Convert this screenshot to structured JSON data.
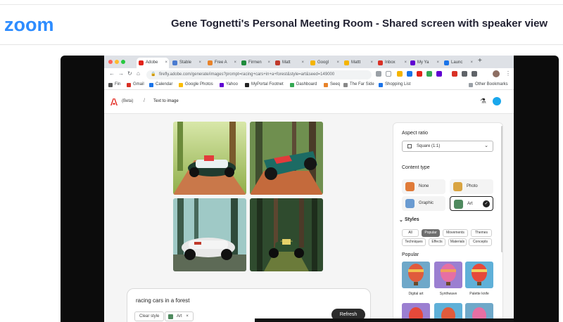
{
  "zoom": {
    "logo": "zoom",
    "meeting_title": "Gene Tognetti's Personal Meeting Room - Shared screen with speaker view"
  },
  "browser": {
    "tabs": [
      {
        "label": "Adobe",
        "icon_color": "#e2231a"
      },
      {
        "label": "Stable",
        "icon_color": "#4a7bd1"
      },
      {
        "label": "Free A",
        "icon_color": "#e8832a"
      },
      {
        "label": "Firmen",
        "icon_color": "#1f8b3b"
      },
      {
        "label": "Matt",
        "icon_color": "#c0392b"
      },
      {
        "label": "Googl",
        "icon_color": "#f4b400"
      },
      {
        "label": "Mattt",
        "icon_color": "#f4b400"
      },
      {
        "label": "Inbox",
        "icon_color": "#d93025"
      },
      {
        "label": "My Ya",
        "icon_color": "#6001d2"
      },
      {
        "label": "Launc",
        "icon_color": "#1a73e8"
      }
    ],
    "new_tab": "+",
    "url": "firefly.adobe.com/generate/images?prompt=racing+cars+in+a+forest&style=art&seed=149000",
    "bookmarks": [
      {
        "label": "Fin",
        "icon_color": "#555555"
      },
      {
        "label": "Gmail",
        "icon_color": "#d93025"
      },
      {
        "label": "Calendar",
        "icon_color": "#1a73e8"
      },
      {
        "label": "Google Photos",
        "icon_color": "#fbbc04"
      },
      {
        "label": "Yahoo",
        "icon_color": "#6001d2"
      },
      {
        "label": "MyPortal Footnet",
        "icon_color": "#222222"
      },
      {
        "label": "Dashboard",
        "icon_color": "#34a853"
      },
      {
        "label": "Seeq",
        "icon_color": "#e8832a"
      },
      {
        "label": "The Far Side",
        "icon_color": "#888888"
      },
      {
        "label": "Shopping List",
        "icon_color": "#1a73e8"
      }
    ],
    "other_bookmarks": "Other Bookmarks"
  },
  "firefly": {
    "beta": "(Beta)",
    "separator": "/",
    "breadcrumb": "Text to image",
    "prompt": "racing cars in a forest",
    "clear_styles": "Clear style",
    "art_chip": "Art",
    "refresh": "Refresh",
    "panel": {
      "aspect_ratio_title": "Aspect ratio",
      "aspect_ratio_value": "Square (1:1)",
      "content_type_title": "Content type",
      "content_types": [
        {
          "label": "None",
          "selected": false,
          "icon_color": "#e07b39"
        },
        {
          "label": "Photo",
          "selected": false,
          "icon_color": "#d9a441"
        },
        {
          "label": "Graphic",
          "selected": false,
          "icon_color": "#6a9bd1"
        },
        {
          "label": "Art",
          "selected": true,
          "icon_color": "#4f8a5f"
        }
      ],
      "styles_title": "Styles",
      "style_tabs_row1": [
        {
          "label": "All",
          "active": false
        },
        {
          "label": "Popular",
          "active": true
        },
        {
          "label": "Movements",
          "active": false
        },
        {
          "label": "Themes",
          "active": false
        }
      ],
      "style_tabs_row2": [
        {
          "label": "Techniques",
          "active": false
        },
        {
          "label": "Effects",
          "active": false
        },
        {
          "label": "Materials",
          "active": false
        },
        {
          "label": "Concepts",
          "active": false
        }
      ],
      "popular_title": "Popular",
      "thumbnails": [
        {
          "label": "Digital art"
        },
        {
          "label": "Synthwave"
        },
        {
          "label": "Palette knife"
        }
      ]
    }
  }
}
